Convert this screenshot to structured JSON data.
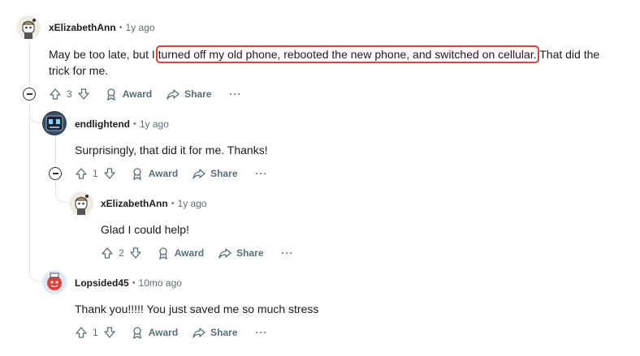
{
  "comments": [
    {
      "username": "xElizabethAnn",
      "time": "1y ago",
      "text_before": "May be too late, but I ",
      "text_highlight": "turned off my old phone, rebooted the new phone, and switched on cellular.",
      "text_after": " That did the trick for me.",
      "votes": "3",
      "award_label": "Award",
      "share_label": "Share",
      "more_label": "···"
    },
    {
      "username": "endlightend",
      "time": "1y ago",
      "text": "Surprisingly, that did it for me. Thanks!",
      "votes": "1",
      "award_label": "Award",
      "share_label": "Share",
      "more_label": "···"
    },
    {
      "username": "xElizabethAnn",
      "time": "1y ago",
      "text": "Glad I could help!",
      "votes": "2",
      "award_label": "Award",
      "share_label": "Share",
      "more_label": "···"
    },
    {
      "username": "Lopsided45",
      "time": "10mo ago",
      "text": "Thank you!!!!! You just saved me so much stress",
      "votes": "1",
      "award_label": "Award",
      "share_label": "Share",
      "more_label": "···"
    }
  ],
  "separator": "•",
  "colors": {
    "highlight_border": "#e0413b",
    "meta_gray": "#576f76",
    "thread_line": "#e5e5e5"
  }
}
